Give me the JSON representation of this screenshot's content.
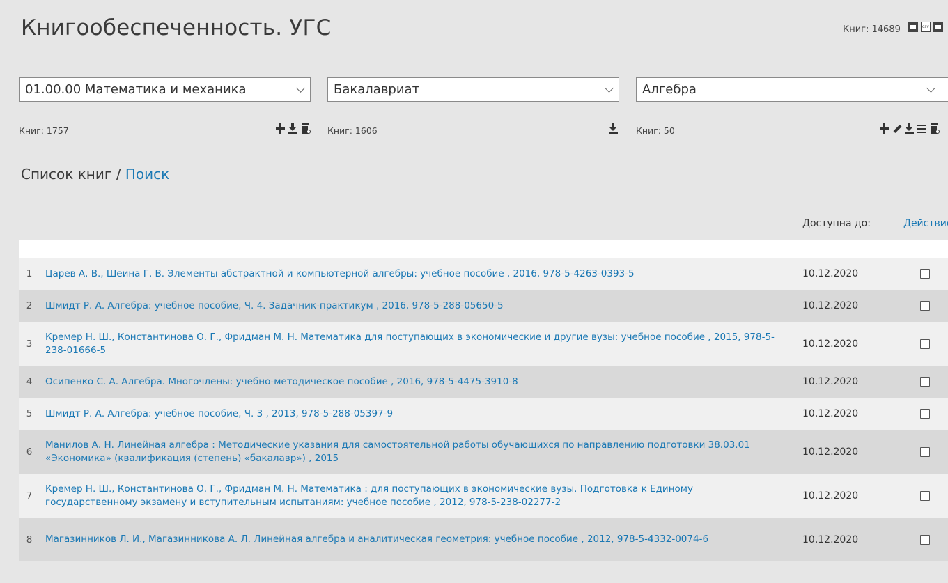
{
  "header": {
    "title": "Книгообеспеченность. УГС",
    "books_total": "Книг: 14689",
    "export_icons": [
      "excel-icon",
      "csv-icon",
      "excel-icon"
    ]
  },
  "filters": [
    {
      "selected": "01.00.00 Математика и механика",
      "count": "Книг: 1757",
      "actions": [
        "plus-icon",
        "download-icon",
        "delete-icon"
      ]
    },
    {
      "selected": "Бакалавриат",
      "count": "Книг: 1606",
      "actions": [
        "download-icon"
      ]
    },
    {
      "selected": "Алгебра",
      "count": "Книг: 50",
      "actions": [
        "plus-icon",
        "edit-icon",
        "download-icon",
        "list-icon",
        "delete-icon"
      ]
    }
  ],
  "list_heading": {
    "label": "Список книг",
    "separator": " / ",
    "search_link": "Поиск"
  },
  "table": {
    "col_available": "Доступна до:",
    "col_actions": "Действие",
    "rows": [
      {
        "num": "1",
        "text": "Царев А. В., Шеина Г. В. Элементы абстрактной и компьютерной алгебры: учебное пособие , 2016, 978-5-4263-0393-5",
        "date": "10.12.2020",
        "checked": false
      },
      {
        "num": "2",
        "text": "Шмидт Р. А. Алгебра: учебное пособие, Ч. 4. Задачник-практикум , 2016, 978-5-288-05650-5",
        "date": "10.12.2020",
        "checked": false
      },
      {
        "num": "3",
        "text": "Кремер Н. Ш., Константинова О. Г., Фридман М. Н. Математика для поступающих в экономические и другие вузы: учебное пособие , 2015, 978-5-238-01666-5",
        "date": "10.12.2020",
        "checked": false
      },
      {
        "num": "4",
        "text": "Осипенко С. А. Алгебра. Многочлены: учебно-методическое пособие , 2016, 978-5-4475-3910-8",
        "date": "10.12.2020",
        "checked": false
      },
      {
        "num": "5",
        "text": "Шмидт Р. А. Алгебра: учебное пособие, Ч. 3 , 2013, 978-5-288-05397-9",
        "date": "10.12.2020",
        "checked": false
      },
      {
        "num": "6",
        "text": "Манилов А. Н. Линейная алгебра : Методические указания для самостоятельной работы обучающихся по направлению подготовки 38.03.01 «Экономика» (квалификация (степень) «бакалавр») , 2015",
        "date": "10.12.2020",
        "checked": false
      },
      {
        "num": "7",
        "text": "Кремер Н. Ш., Константинова О. Г., Фридман М. Н. Математика : для поступающих в экономические вузы. Подготовка к Единому государственному экзамену и вступительным испытаниям: учебное пособие , 2012, 978-5-238-02277-2",
        "date": "10.12.2020",
        "checked": false
      },
      {
        "num": "8",
        "text": "Магазинников Л. И., Магазинникова А. Л. Линейная алгебра и аналитическая геометрия: учебное пособие , 2012, 978-5-4332-0074-6",
        "date": "10.12.2020",
        "checked": false
      }
    ]
  }
}
